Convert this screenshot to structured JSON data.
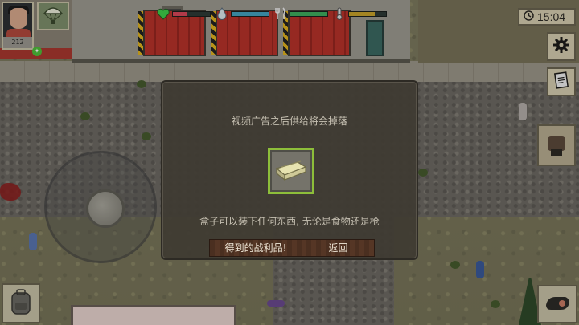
{
  "hud": {
    "player_count": "212",
    "notification_badge": "✦",
    "clock_time": "15:04",
    "colors": {
      "health": "#d8475a",
      "water": "#43a3c0",
      "food": "#3fae5e",
      "temperature": "#c8a32b"
    },
    "icons": [
      "heart-icon",
      "water-drop-icon",
      "fork-knife-icon",
      "thermometer-icon",
      "gear-icon",
      "notes-icon",
      "backpack-icon",
      "fist-icon",
      "parachute-icon",
      "clock-icon"
    ]
  },
  "dialog": {
    "title": "视频广告之后供给将会掉落",
    "description": "盒子可以装下任何东西, 无论是食物还是枪",
    "loot_item": "supply-crate-icon",
    "loot_highlight_color": "#8dbe3a",
    "buttons": {
      "get_loot": "得到的战利品!",
      "back": "返回"
    }
  }
}
